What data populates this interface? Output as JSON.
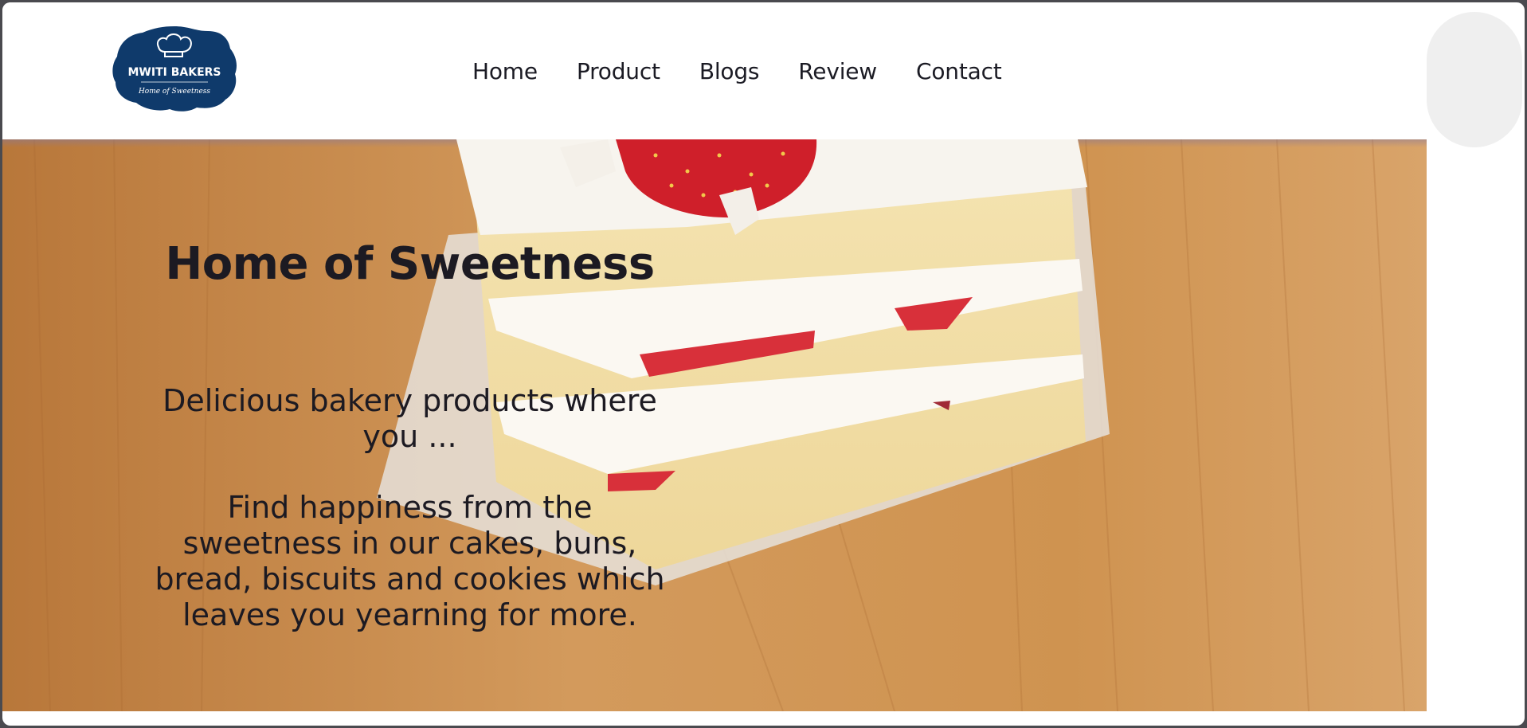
{
  "brand": {
    "logo_text": "MWITI BAKERS",
    "logo_tagline": "Home of Sweetness",
    "logo_color": "#0f3a6b"
  },
  "nav": {
    "items": [
      {
        "label": "Home"
      },
      {
        "label": "Product"
      },
      {
        "label": "Blogs"
      },
      {
        "label": "Review"
      },
      {
        "label": "Contact"
      }
    ]
  },
  "hero": {
    "title": "Home of Sweetness",
    "subtitle": "Delicious bakery products where you ...",
    "body": "Find happiness from the sweetness in our cakes, buns, bread, biscuits and cookies which leaves you yearning for more.",
    "image": "strawberry-shortcake-slice"
  },
  "colors": {
    "text": "#1c1a22",
    "wood": "#c98a4a",
    "header_bg": "#ffffff"
  }
}
